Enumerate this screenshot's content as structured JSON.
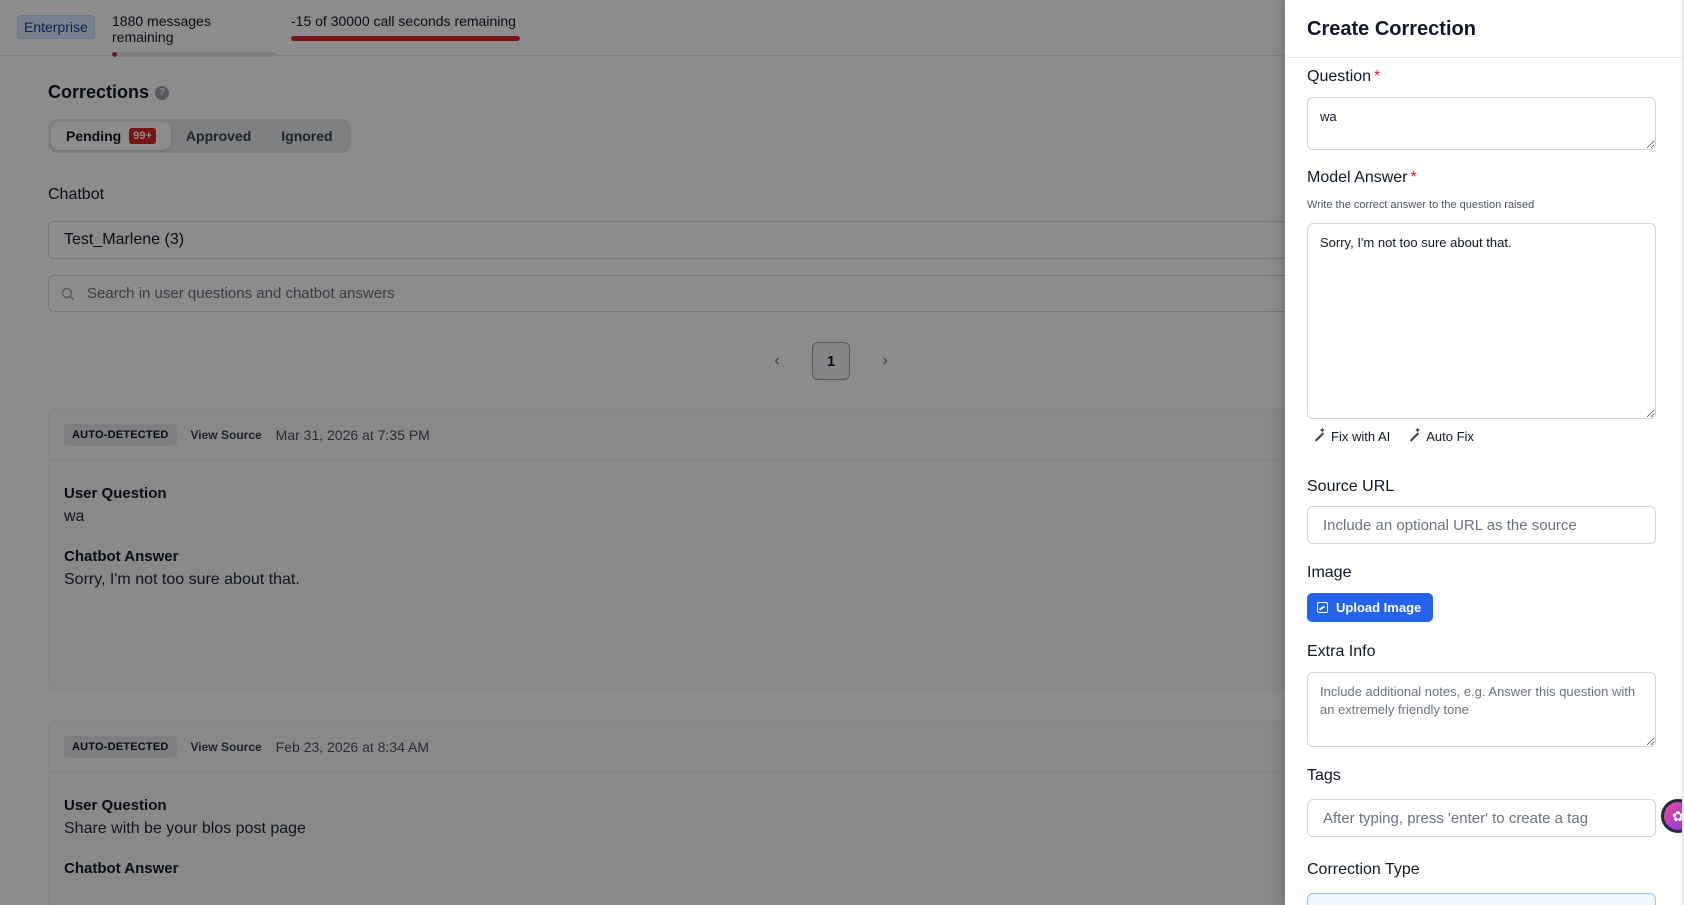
{
  "topbar": {
    "plan": "Enterprise",
    "messages": {
      "label": "1880 messages remaining",
      "fraction_used": 0.03,
      "color": "#dc2626"
    },
    "calls": {
      "label": "-15 of 30000 call seconds remaining",
      "fraction_used": 1.0,
      "color": "#dc2626"
    }
  },
  "page": {
    "title": "Corrections",
    "help_icon": "question-circle-icon",
    "tabs": [
      {
        "label": "Pending",
        "badge": "99+",
        "active": true
      },
      {
        "label": "Approved",
        "active": false
      },
      {
        "label": "Ignored",
        "active": false
      }
    ],
    "chatbot_label": "Chatbot",
    "chatbot_value": "Test_Marlene (3)",
    "search_placeholder": "Search in user questions and chatbot answers",
    "pager": {
      "prev": "‹",
      "current": "1",
      "next": "›"
    },
    "cards": [
      {
        "badge": "AUTO-DETECTED",
        "view_source": "View Source",
        "date": "Mar 31, 2026 at 7:35 PM",
        "question_title": "User Question",
        "question": "wa",
        "answer_title": "Chatbot Answer",
        "answer": "Sorry, I'm not too sure about that."
      },
      {
        "badge": "AUTO-DETECTED",
        "view_source": "View Source",
        "date": "Feb 23, 2026 at 8:34 AM",
        "question_title": "User Question",
        "question": "Share with be your blos post page",
        "answer_title": "Chatbot Answer"
      }
    ]
  },
  "drawer": {
    "title": "Create Correction",
    "question_label": "Question",
    "question_value": "wa",
    "model_answer_label": "Model Answer",
    "model_answer_help": "Write the correct answer to the question raised",
    "model_answer_value": "Sorry, I'm not too sure about that.",
    "fix_ai": "Fix with AI",
    "auto_fix": "Auto Fix",
    "source_url_label": "Source URL",
    "source_url_placeholder": "Include an optional URL as the source",
    "image_label": "Image",
    "upload_label": "Upload Image",
    "extra_info_label": "Extra Info",
    "extra_info_placeholder": "Include additional notes, e.g. Answer this question with an extremely friendly tone",
    "tags_label": "Tags",
    "tags_placeholder": "After typing, press 'enter' to create a tag",
    "correction_type_label": "Correction Type",
    "required_mark": "*"
  }
}
